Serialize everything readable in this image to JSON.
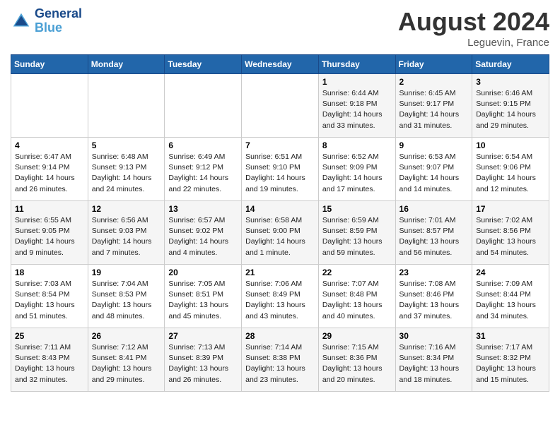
{
  "header": {
    "logo_text_general": "General",
    "logo_text_blue": "Blue",
    "month": "August 2024",
    "location": "Leguevin, France"
  },
  "weekdays": [
    "Sunday",
    "Monday",
    "Tuesday",
    "Wednesday",
    "Thursday",
    "Friday",
    "Saturday"
  ],
  "weeks": [
    [
      {
        "day": "",
        "info": ""
      },
      {
        "day": "",
        "info": ""
      },
      {
        "day": "",
        "info": ""
      },
      {
        "day": "",
        "info": ""
      },
      {
        "day": "1",
        "info": "Sunrise: 6:44 AM\nSunset: 9:18 PM\nDaylight: 14 hours\nand 33 minutes."
      },
      {
        "day": "2",
        "info": "Sunrise: 6:45 AM\nSunset: 9:17 PM\nDaylight: 14 hours\nand 31 minutes."
      },
      {
        "day": "3",
        "info": "Sunrise: 6:46 AM\nSunset: 9:15 PM\nDaylight: 14 hours\nand 29 minutes."
      }
    ],
    [
      {
        "day": "4",
        "info": "Sunrise: 6:47 AM\nSunset: 9:14 PM\nDaylight: 14 hours\nand 26 minutes."
      },
      {
        "day": "5",
        "info": "Sunrise: 6:48 AM\nSunset: 9:13 PM\nDaylight: 14 hours\nand 24 minutes."
      },
      {
        "day": "6",
        "info": "Sunrise: 6:49 AM\nSunset: 9:12 PM\nDaylight: 14 hours\nand 22 minutes."
      },
      {
        "day": "7",
        "info": "Sunrise: 6:51 AM\nSunset: 9:10 PM\nDaylight: 14 hours\nand 19 minutes."
      },
      {
        "day": "8",
        "info": "Sunrise: 6:52 AM\nSunset: 9:09 PM\nDaylight: 14 hours\nand 17 minutes."
      },
      {
        "day": "9",
        "info": "Sunrise: 6:53 AM\nSunset: 9:07 PM\nDaylight: 14 hours\nand 14 minutes."
      },
      {
        "day": "10",
        "info": "Sunrise: 6:54 AM\nSunset: 9:06 PM\nDaylight: 14 hours\nand 12 minutes."
      }
    ],
    [
      {
        "day": "11",
        "info": "Sunrise: 6:55 AM\nSunset: 9:05 PM\nDaylight: 14 hours\nand 9 minutes."
      },
      {
        "day": "12",
        "info": "Sunrise: 6:56 AM\nSunset: 9:03 PM\nDaylight: 14 hours\nand 7 minutes."
      },
      {
        "day": "13",
        "info": "Sunrise: 6:57 AM\nSunset: 9:02 PM\nDaylight: 14 hours\nand 4 minutes."
      },
      {
        "day": "14",
        "info": "Sunrise: 6:58 AM\nSunset: 9:00 PM\nDaylight: 14 hours\nand 1 minute."
      },
      {
        "day": "15",
        "info": "Sunrise: 6:59 AM\nSunset: 8:59 PM\nDaylight: 13 hours\nand 59 minutes."
      },
      {
        "day": "16",
        "info": "Sunrise: 7:01 AM\nSunset: 8:57 PM\nDaylight: 13 hours\nand 56 minutes."
      },
      {
        "day": "17",
        "info": "Sunrise: 7:02 AM\nSunset: 8:56 PM\nDaylight: 13 hours\nand 54 minutes."
      }
    ],
    [
      {
        "day": "18",
        "info": "Sunrise: 7:03 AM\nSunset: 8:54 PM\nDaylight: 13 hours\nand 51 minutes."
      },
      {
        "day": "19",
        "info": "Sunrise: 7:04 AM\nSunset: 8:53 PM\nDaylight: 13 hours\nand 48 minutes."
      },
      {
        "day": "20",
        "info": "Sunrise: 7:05 AM\nSunset: 8:51 PM\nDaylight: 13 hours\nand 45 minutes."
      },
      {
        "day": "21",
        "info": "Sunrise: 7:06 AM\nSunset: 8:49 PM\nDaylight: 13 hours\nand 43 minutes."
      },
      {
        "day": "22",
        "info": "Sunrise: 7:07 AM\nSunset: 8:48 PM\nDaylight: 13 hours\nand 40 minutes."
      },
      {
        "day": "23",
        "info": "Sunrise: 7:08 AM\nSunset: 8:46 PM\nDaylight: 13 hours\nand 37 minutes."
      },
      {
        "day": "24",
        "info": "Sunrise: 7:09 AM\nSunset: 8:44 PM\nDaylight: 13 hours\nand 34 minutes."
      }
    ],
    [
      {
        "day": "25",
        "info": "Sunrise: 7:11 AM\nSunset: 8:43 PM\nDaylight: 13 hours\nand 32 minutes."
      },
      {
        "day": "26",
        "info": "Sunrise: 7:12 AM\nSunset: 8:41 PM\nDaylight: 13 hours\nand 29 minutes."
      },
      {
        "day": "27",
        "info": "Sunrise: 7:13 AM\nSunset: 8:39 PM\nDaylight: 13 hours\nand 26 minutes."
      },
      {
        "day": "28",
        "info": "Sunrise: 7:14 AM\nSunset: 8:38 PM\nDaylight: 13 hours\nand 23 minutes."
      },
      {
        "day": "29",
        "info": "Sunrise: 7:15 AM\nSunset: 8:36 PM\nDaylight: 13 hours\nand 20 minutes."
      },
      {
        "day": "30",
        "info": "Sunrise: 7:16 AM\nSunset: 8:34 PM\nDaylight: 13 hours\nand 18 minutes."
      },
      {
        "day": "31",
        "info": "Sunrise: 7:17 AM\nSunset: 8:32 PM\nDaylight: 13 hours\nand 15 minutes."
      }
    ]
  ]
}
